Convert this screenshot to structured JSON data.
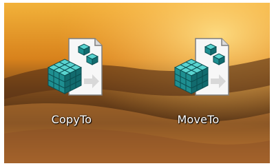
{
  "desktop": {
    "icons": [
      {
        "label": "CopyTo",
        "icon": "registry-file-icon"
      },
      {
        "label": "MoveTo",
        "icon": "registry-file-icon"
      }
    ]
  },
  "colors": {
    "label_text": "#ffffff",
    "cube_teal": "#2fb7b3",
    "cube_dark": "#0d6f72",
    "sheet_white": "#f7f7f7"
  }
}
